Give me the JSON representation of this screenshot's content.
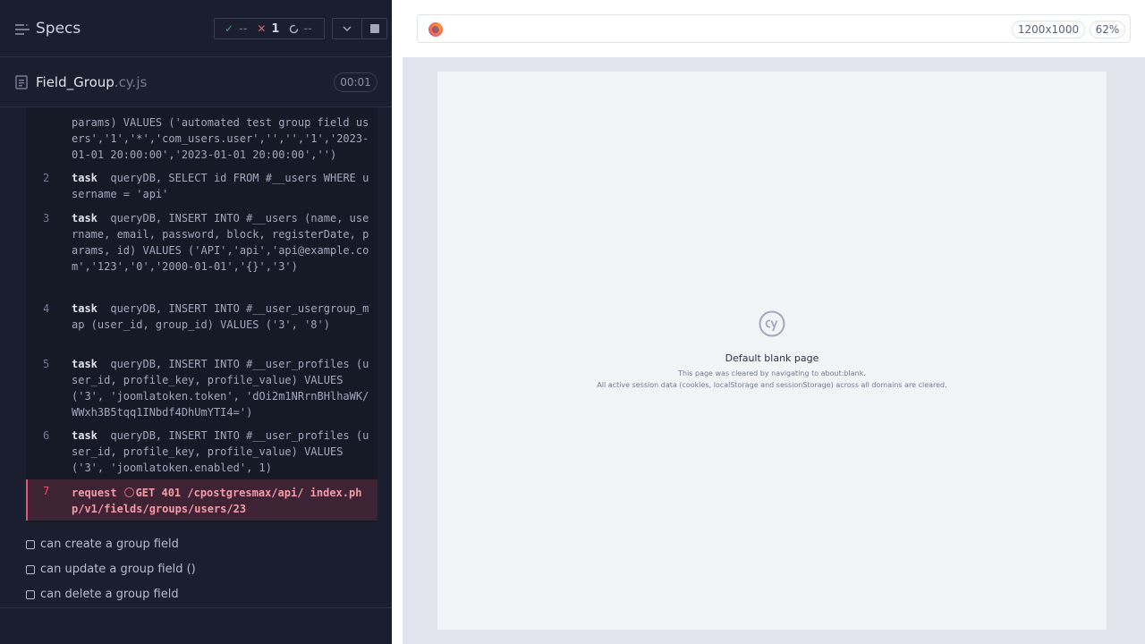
{
  "specs_header": {
    "title": "Specs",
    "passed": "--",
    "failed": "1",
    "pending": "--"
  },
  "file": {
    "name": "Field_Group",
    "ext": ".cy.js",
    "duration": "00:01"
  },
  "commands": [
    {
      "num": "",
      "kw": "",
      "text": "params) VALUES ('automated test group field users','1','*','com_users.user','','','1','2023-01-01 20:00:00','2023-01-01 20:00:00','')"
    },
    {
      "num": "2",
      "kw": "task",
      "text": "queryDB, SELECT id FROM #__users WHERE username = 'api'"
    },
    {
      "num": "3",
      "kw": "task",
      "text": "queryDB, INSERT INTO #__users (name, username, email, password, block, registerDate, params, id) VALUES ('API','api','api@example.com','123','0','2000-01-01','{}','3')"
    },
    {
      "num": "4",
      "kw": "task",
      "text": "queryDB, INSERT INTO #__user_usergroup_map (user_id, group_id) VALUES ('3', '8')"
    },
    {
      "num": "5",
      "kw": "task",
      "text": "queryDB, INSERT INTO #__user_profiles (user_id, profile_key, profile_value) VALUES ('3', 'joomlatoken.token', 'dOi2m1NRrnBHlhaWK/WWxh3B5tqq1INbdf4DhUmYTI4=')"
    },
    {
      "num": "6",
      "kw": "task",
      "text": "queryDB, INSERT INTO #__user_profiles (user_id, profile_key, profile_value) VALUES ('3', 'joomlatoken.enabled', 1)"
    },
    {
      "num": "7",
      "kw": "request",
      "text": "GET 401 /cpostgresmax/api/ index.php/v1/fields/groups/users/23"
    }
  ],
  "tests": [
    {
      "label": "can create a group field"
    },
    {
      "label": "can update a group field ()"
    },
    {
      "label": "can delete a group field"
    }
  ],
  "aut": {
    "viewport": "1200x1000",
    "zoom": "62%",
    "blank_title": "Default blank page",
    "blank_line1": "This page was cleared by navigating to about:blank.",
    "blank_line2": "All active session data (cookies, localStorage and sessionStorage) across all domains are cleared."
  },
  "colors": {
    "pass": "#1fa971",
    "fail": "#e45770",
    "reporter_bg": "#1b1e2e"
  }
}
